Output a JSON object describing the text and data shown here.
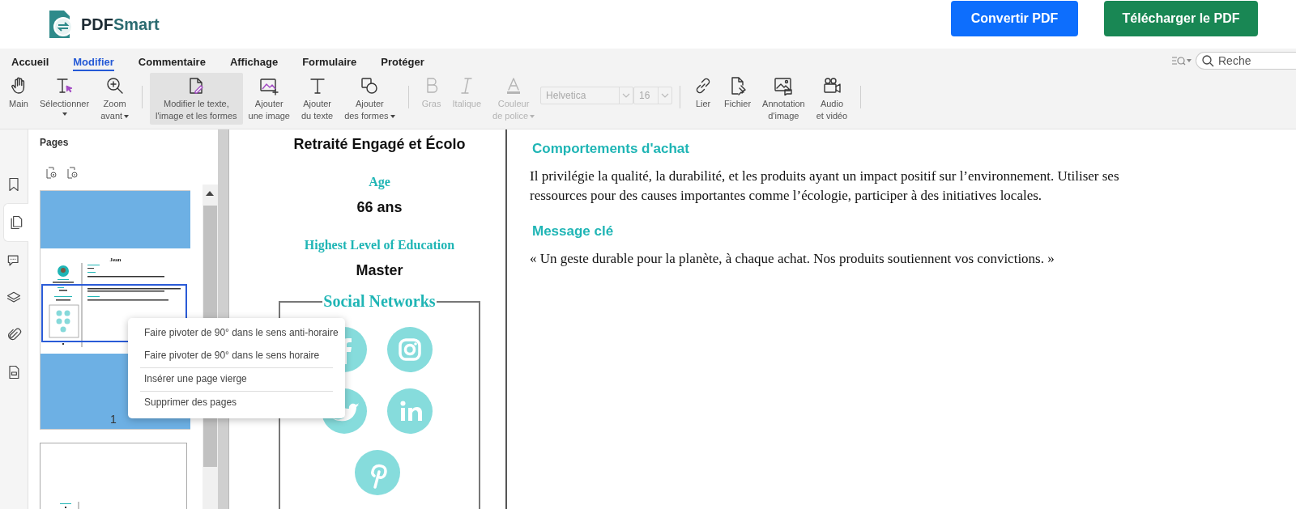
{
  "header": {
    "logo": {
      "part_1": "PDF",
      "part_2": "Smart"
    },
    "buttons": [
      {
        "label": "Convertir PDF",
        "kind": "primary"
      },
      {
        "label": "Télécharger le PDF",
        "kind": "success"
      }
    ]
  },
  "ribbon": {
    "tabs": [
      {
        "label": "Accueil",
        "selected": false
      },
      {
        "label": "Modifier",
        "selected": true
      },
      {
        "label": "Commentaire",
        "selected": false
      },
      {
        "label": "Affichage",
        "selected": false
      },
      {
        "label": "Formulaire",
        "selected": false
      },
      {
        "label": "Protéger",
        "selected": false
      }
    ],
    "search": {
      "placeholder": "Reche"
    },
    "tools": [
      {
        "kind": "tool",
        "label": "Main",
        "dropdown": false,
        "selected": false,
        "disabled": false
      },
      {
        "kind": "tool",
        "label": "Sélectionner",
        "dropdown": true,
        "selected": false,
        "disabled": false
      },
      {
        "kind": "tool",
        "label": "Zoom\navant",
        "dropdown": true,
        "selected": false,
        "disabled": false
      },
      {
        "kind": "divider"
      },
      {
        "kind": "tool",
        "label": "Modifier le texte,\nl'image et les formes",
        "dropdown": false,
        "selected": true,
        "disabled": false
      },
      {
        "kind": "tool",
        "label": "Ajouter\nune image",
        "dropdown": false,
        "selected": false,
        "disabled": false
      },
      {
        "kind": "tool",
        "label": "Ajouter\ndu texte",
        "dropdown": false,
        "selected": false,
        "disabled": false
      },
      {
        "kind": "tool",
        "label": "Ajouter\ndes formes",
        "dropdown": true,
        "selected": false,
        "disabled": false
      },
      {
        "kind": "divider"
      },
      {
        "kind": "tool",
        "label": "Gras",
        "dropdown": false,
        "selected": false,
        "disabled": true
      },
      {
        "kind": "tool",
        "label": "Italique",
        "dropdown": false,
        "selected": false,
        "disabled": true
      },
      {
        "kind": "tool",
        "label": "Couleur\nde police",
        "dropdown": true,
        "selected": false,
        "disabled": true
      },
      {
        "kind": "select",
        "value": "Helvetica",
        "disabled": true
      },
      {
        "kind": "select",
        "value": "16",
        "disabled": true
      },
      {
        "kind": "divider"
      },
      {
        "kind": "tool",
        "label": "Lier",
        "dropdown": false,
        "selected": false,
        "disabled": false
      },
      {
        "kind": "tool",
        "label": "Fichier",
        "dropdown": false,
        "selected": false,
        "disabled": false
      },
      {
        "kind": "tool",
        "label": "Annotation\nd'image",
        "dropdown": false,
        "selected": false,
        "disabled": false
      },
      {
        "kind": "tool",
        "label": "Audio\net vidéo",
        "dropdown": false,
        "selected": false,
        "disabled": false
      },
      {
        "kind": "divider"
      }
    ]
  },
  "side_rail": {
    "items": [
      {
        "selected": false
      },
      {
        "selected": true
      },
      {
        "selected": false
      },
      {
        "selected": false
      },
      {
        "selected": false
      },
      {
        "selected": false
      }
    ]
  },
  "pages_panel": {
    "title": "Pages",
    "thumbnail": {
      "title": "Jean",
      "page_number": "1"
    }
  },
  "context_menu": {
    "items": [
      {
        "label": "Faire pivoter de 90° dans le sens anti-horaire",
        "separator_before": false
      },
      {
        "label": "Faire pivoter de 90° dans le sens horaire",
        "separator_before": false
      },
      {
        "label": "Insérer une page vierge",
        "separator_before": true
      },
      {
        "label": "Supprimer des pages",
        "separator_before": true
      }
    ]
  },
  "document": {
    "left": {
      "title": "Retraité Engagé et Écolo",
      "fields": [
        {
          "label": "Age",
          "value": "66 ans"
        },
        {
          "label": "Highest Level of Education",
          "value": "Master"
        }
      ],
      "social": {
        "title": "Social Networks"
      }
    },
    "right": {
      "sections": [
        {
          "heading": "Comportements d'achat",
          "text": "Il privilégie la qualité, la durabilité, et les produits ayant un impact positif sur l’environnement. Utiliser ses ressources pour des causes importantes comme l’écologie, participer à des initiatives locales."
        },
        {
          "heading": "Message clé",
          "text": "« Un geste durable pour la planète, à chaque achat. Nos produits soutiennent vos convictions. »"
        }
      ]
    }
  }
}
